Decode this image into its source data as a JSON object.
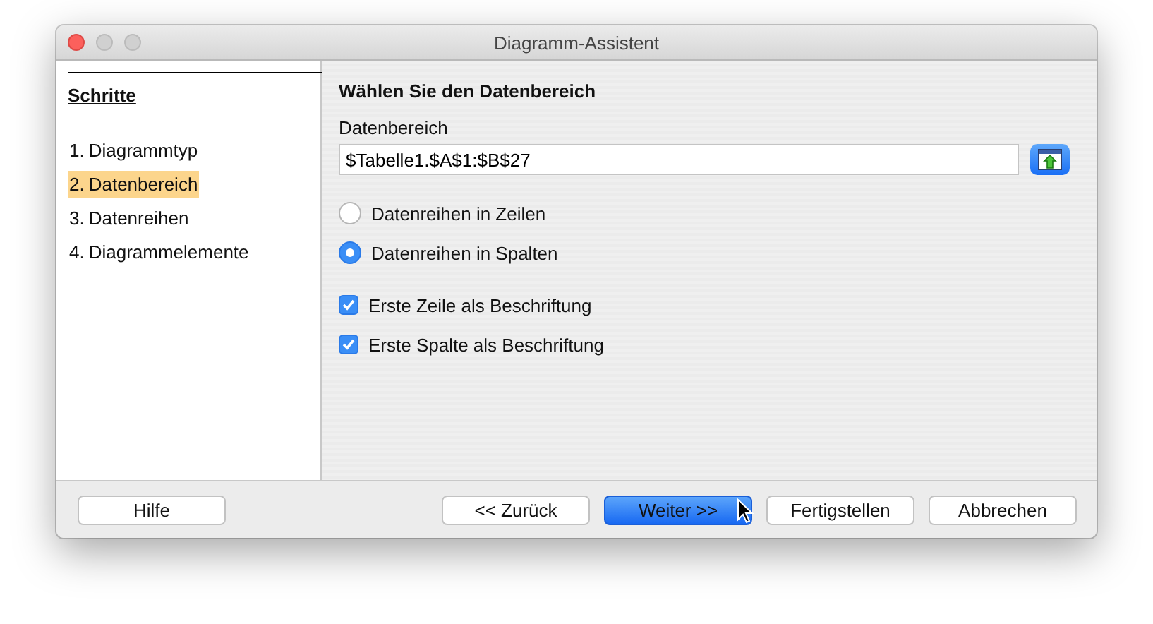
{
  "window": {
    "title": "Diagramm-Assistent"
  },
  "sidebar": {
    "heading": "Schritte",
    "items": [
      {
        "number": "1.",
        "label": "Diagrammtyp",
        "selected": false
      },
      {
        "number": "2.",
        "label": "Datenbereich",
        "selected": true
      },
      {
        "number": "3.",
        "label": "Datenreihen",
        "selected": false
      },
      {
        "number": "4.",
        "label": "Diagrammelemente",
        "selected": false
      }
    ]
  },
  "content": {
    "heading": "Wählen Sie den Datenbereich",
    "range_label": "Datenbereich",
    "range_value": "$Tabelle1.$A$1:$B$27",
    "radios": [
      {
        "label": "Datenreihen in Zeilen",
        "selected": false
      },
      {
        "label": "Datenreihen in Spalten",
        "selected": true
      }
    ],
    "checkboxes": [
      {
        "label": "Erste Zeile als Beschriftung",
        "checked": true
      },
      {
        "label": "Erste Spalte als Beschriftung",
        "checked": true
      }
    ]
  },
  "buttons": [
    {
      "label": "Hilfe",
      "default": false
    },
    {
      "label": "<< Zurück",
      "default": false
    },
    {
      "label": "Weiter >>",
      "default": true
    },
    {
      "label": "Fertigstellen",
      "default": false
    },
    {
      "label": "Abbrechen",
      "default": false
    }
  ]
}
